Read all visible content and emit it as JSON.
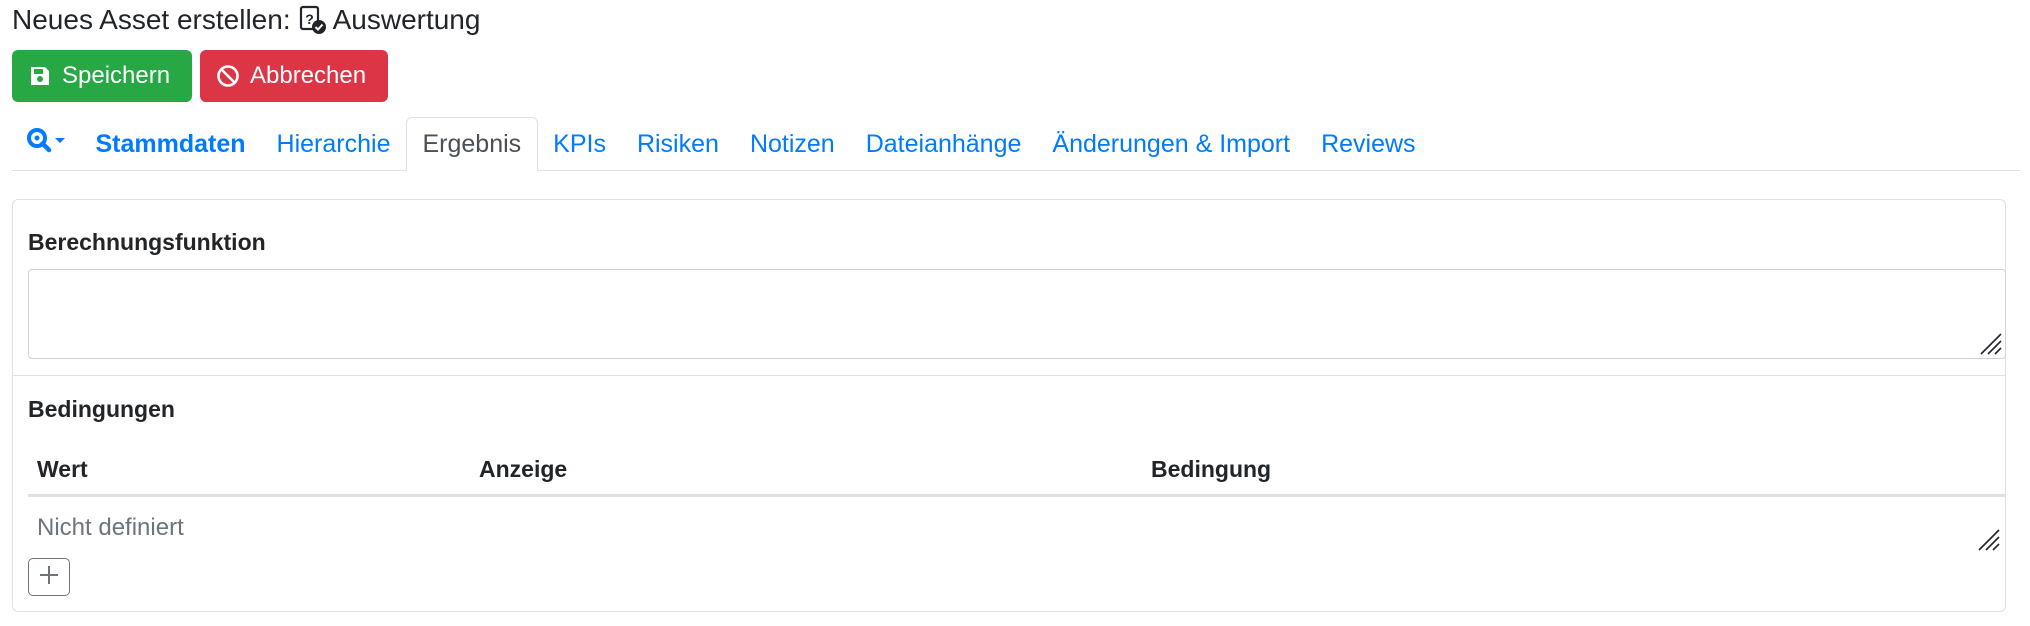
{
  "page": {
    "title_prefix": "Neues Asset erstellen:",
    "asset_type": "Auswertung",
    "asset_type_icon": "question-document-check-icon"
  },
  "toolbar": {
    "save_label": "Speichern",
    "save_icon": "floppy-disk-icon",
    "cancel_label": "Abbrechen",
    "cancel_icon": "ban-icon",
    "colors": {
      "save": "#28a745",
      "cancel": "#dc3545"
    }
  },
  "tabs": {
    "search_icon": "search-location-icon",
    "items": [
      {
        "label": "Stammdaten",
        "active": false,
        "bold": true
      },
      {
        "label": "Hierarchie",
        "active": false
      },
      {
        "label": "Ergebnis",
        "active": true
      },
      {
        "label": "KPIs",
        "active": false
      },
      {
        "label": "Risiken",
        "active": false
      },
      {
        "label": "Notizen",
        "active": false
      },
      {
        "label": "Dateianhänge",
        "active": false
      },
      {
        "label": "Änderungen & Import",
        "active": false
      },
      {
        "label": "Reviews",
        "active": false
      }
    ],
    "link_color": "#007bff"
  },
  "main": {
    "calculation": {
      "label": "Berechnungsfunktion",
      "value": ""
    },
    "conditions": {
      "label": "Bedingungen",
      "columns": [
        "Wert",
        "Anzeige",
        "Bedingung"
      ],
      "rows": [],
      "empty_text": "Nicht definiert",
      "add_icon": "plus-icon"
    }
  }
}
